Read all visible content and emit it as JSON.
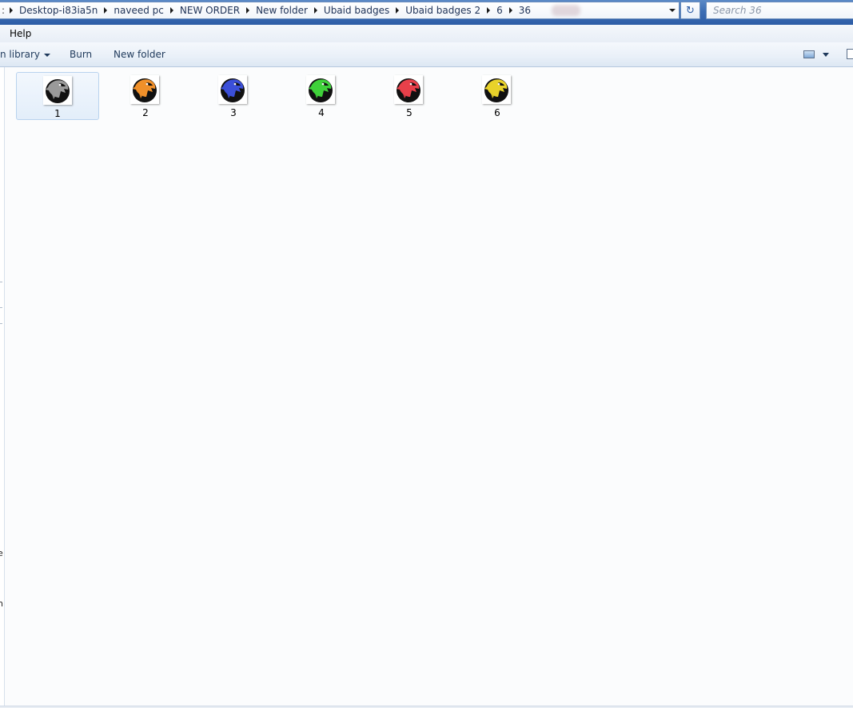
{
  "address_bar": {
    "crumbs": [
      "Desktop-i83ia5n",
      "naveed pc",
      "NEW ORDER",
      "New folder",
      "Ubaid badges",
      "Ubaid badges 2",
      "6",
      "36"
    ],
    "leading_fragment": ":"
  },
  "refresh_glyph": "↻",
  "search": {
    "placeholder": "Search 36"
  },
  "menu": {
    "help": "Help"
  },
  "toolbar": {
    "include_in_library": "n library",
    "burn": "Burn",
    "new_folder": "New folder"
  },
  "left_pane_fragments": [
    "e",
    "n"
  ],
  "files": [
    {
      "name": "1",
      "color": "#9a9a9a",
      "selected": true
    },
    {
      "name": "2",
      "color": "#f0902a",
      "selected": false
    },
    {
      "name": "3",
      "color": "#3b4fd8",
      "selected": false
    },
    {
      "name": "4",
      "color": "#3fd13a",
      "selected": false
    },
    {
      "name": "5",
      "color": "#e8404a",
      "selected": false
    },
    {
      "name": "6",
      "color": "#e8d22a",
      "selected": false
    }
  ],
  "icons": {
    "thumb": "eagle-badge-icon",
    "view": "view-options-icon",
    "pane": "preview-pane-icon"
  }
}
